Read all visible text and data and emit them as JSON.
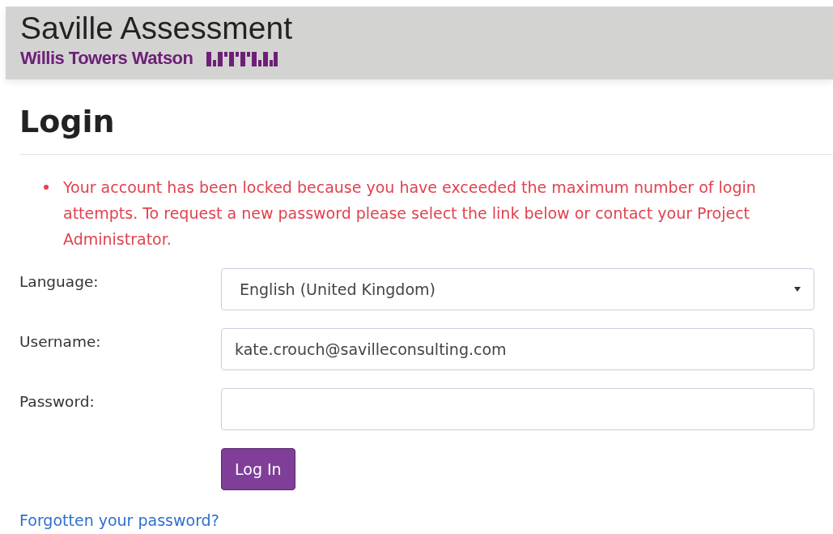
{
  "header": {
    "title": "Saville Assessment",
    "brand": "Willis Towers Watson"
  },
  "page": {
    "heading": "Login"
  },
  "errors": [
    "Your account has been locked because you have exceeded the maximum number of login attempts. To request a new password please select the link below or contact your Project Administrator."
  ],
  "form": {
    "fields": [
      {
        "kind": "select",
        "label": "Language:",
        "value": "English (United Kingdom)"
      },
      {
        "kind": "text",
        "label": "Username:",
        "value": "kate.crouch@savilleconsulting.com"
      },
      {
        "kind": "password",
        "label": "Password:"
      }
    ],
    "submit": "Log In"
  },
  "forgot_link": "Forgotten your password?"
}
